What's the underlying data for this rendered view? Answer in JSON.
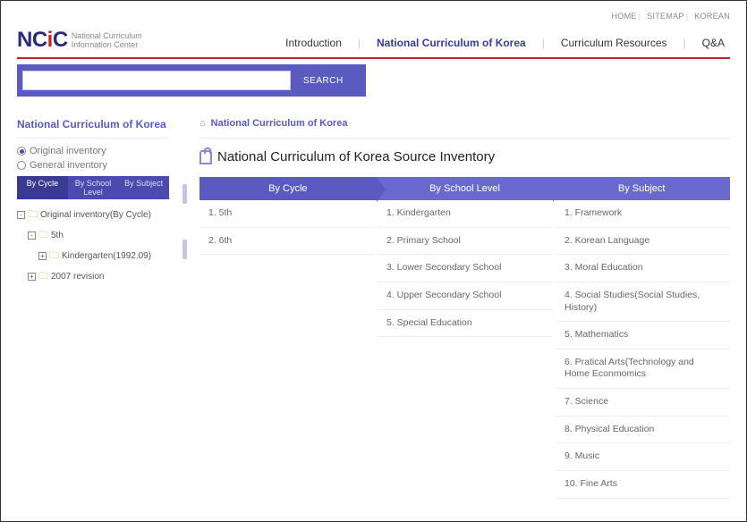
{
  "toplinks": [
    "HOME",
    "SITEMAP",
    "KOREAN"
  ],
  "logo": {
    "main_a": "NC",
    "main_i": "i",
    "main_c": "C",
    "sub1": "National Curriculum",
    "sub2": "Information Center"
  },
  "nav": [
    "Introduction",
    "National Curriculum of Korea",
    "Curriculum Resources",
    "Q&A"
  ],
  "nav_active": 1,
  "search": {
    "button": "SEARCH",
    "value": ""
  },
  "sidebar": {
    "title": "National Curriculum of Korea",
    "radios": [
      "Original inventory",
      "General inventory"
    ],
    "radio_selected": 0,
    "tabs": [
      "By Cycle",
      "By School Level",
      "By Subject"
    ],
    "tab_active": 0,
    "tree": {
      "root": "Original inventory(By Cycle)",
      "n1": "5th",
      "n1a": "Kindergarten(1992.09)",
      "n2": "2007 revision"
    }
  },
  "breadcrumb": {
    "current": "National Curriculum of Korea"
  },
  "page_title": "National Curriculum of Korea Source Inventory",
  "columns": {
    "headers": [
      "By Cycle",
      "By School Level",
      "By Subject"
    ],
    "by_cycle": [
      "1. 5th",
      "2. 6th"
    ],
    "by_school": [
      "1. Kindergarten",
      "2. Primary School",
      "3. Lower Secondary School",
      "4. Upper Secondary School",
      "5. Special Education"
    ],
    "by_subject": [
      "1. Framework",
      "2. Korean Language",
      "3. Moral Education",
      "4. Social Studies(Social Studies, History)",
      "5. Mathematics",
      "6. Pratical Arts(Technology and Home Econmomics",
      "7. Science",
      "8. Physical Education",
      "9. Music",
      "10. Fine Arts"
    ]
  }
}
